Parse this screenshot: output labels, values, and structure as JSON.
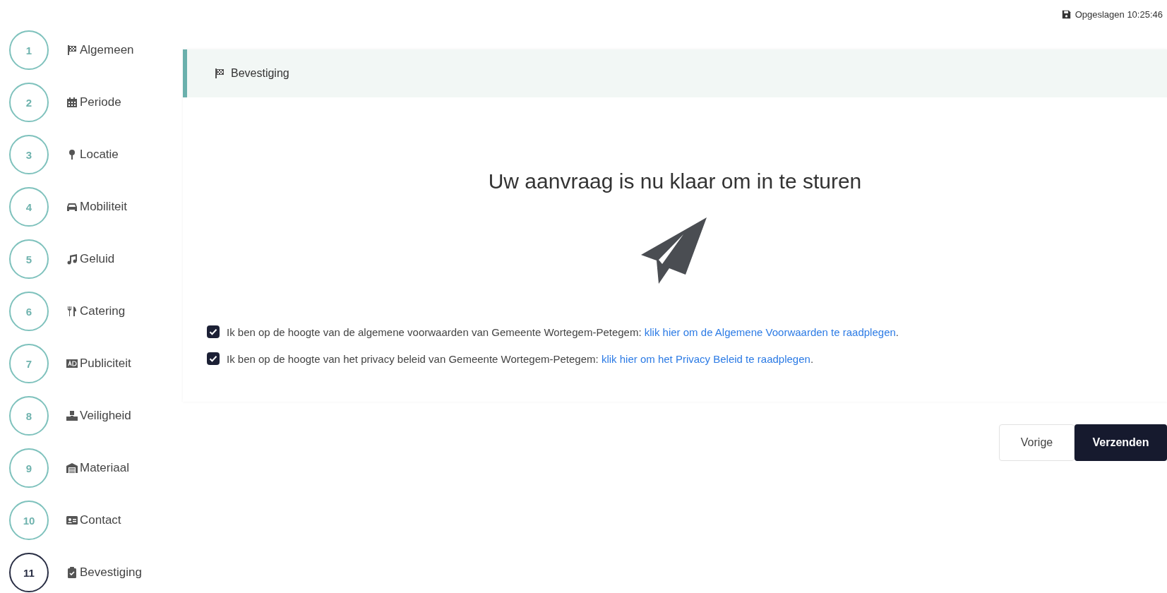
{
  "saved_status": {
    "text": "Opgeslagen 10:25:46"
  },
  "steps": [
    {
      "number": "1",
      "label": "Algemeen",
      "selected": false
    },
    {
      "number": "2",
      "label": "Periode",
      "selected": false
    },
    {
      "number": "3",
      "label": "Locatie",
      "selected": false
    },
    {
      "number": "4",
      "label": "Mobiliteit",
      "selected": false
    },
    {
      "number": "5",
      "label": "Geluid",
      "selected": false
    },
    {
      "number": "6",
      "label": "Catering",
      "selected": false
    },
    {
      "number": "7",
      "label": "Publiciteit",
      "selected": false
    },
    {
      "number": "8",
      "label": "Veiligheid",
      "selected": false
    },
    {
      "number": "9",
      "label": "Materiaal",
      "selected": false
    },
    {
      "number": "10",
      "label": "Contact",
      "selected": false
    },
    {
      "number": "11",
      "label": "Bevestiging",
      "selected": true
    }
  ],
  "section": {
    "title": "Bevestiging",
    "heading": "Uw aanvraag is nu klaar om in te sturen"
  },
  "agreements": [
    {
      "text": "Ik ben op de hoogte van de algemene voorwaarden van Gemeente Wortegem-Petegem:",
      "link": "klik hier om de Algemene Voorwaarden te raadplegen",
      "after": ".",
      "checked": true
    },
    {
      "text": "Ik ben op de hoogte van het privacy beleid van Gemeente Wortegem-Petegem:",
      "link": "klik hier om het Privacy Beleid te raadplegen",
      "after": ".",
      "checked": true
    }
  ],
  "buttons": [
    {
      "label": "Vorige",
      "kind": "secondary"
    },
    {
      "label": "Verzenden",
      "kind": "primary"
    }
  ]
}
